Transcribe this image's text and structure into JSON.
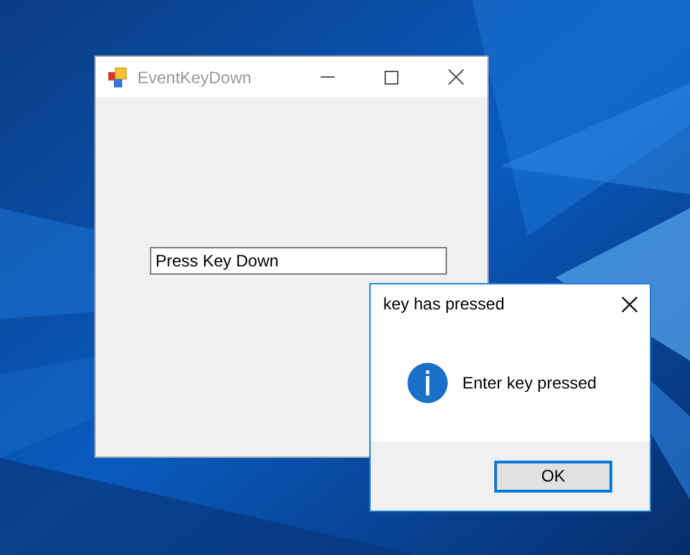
{
  "main_window": {
    "title": "EventKeyDown",
    "active": false,
    "text_field": {
      "value": "Press Key Down"
    }
  },
  "message_box": {
    "title": "key has pressed",
    "message": "Enter key pressed",
    "buttons": [
      {
        "label": "OK",
        "focused": true
      }
    ]
  }
}
